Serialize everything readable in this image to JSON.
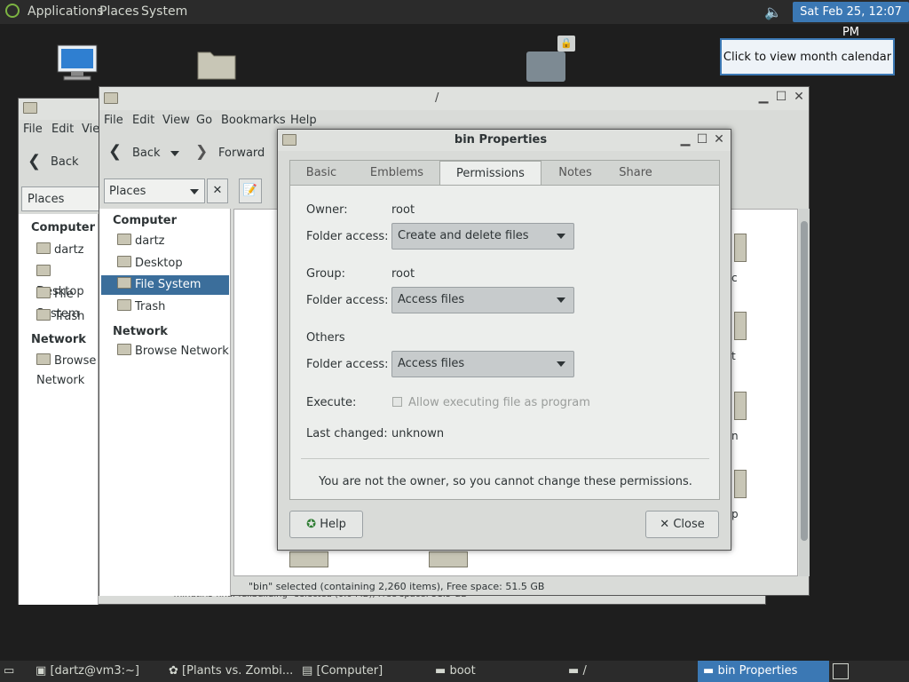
{
  "top_panel": {
    "menus": [
      "Applications",
      "Places",
      "System"
    ],
    "clock": "Sat Feb 25, 12:07 PM",
    "tooltip": "Click to view month calendar"
  },
  "desktop": {
    "icons": [
      {
        "label": "Computer",
        "icon": "computer-icon"
      },
      {
        "label": "",
        "icon": "folder-icon"
      }
    ]
  },
  "back_window": {
    "menus": [
      "File",
      "Edit",
      "View"
    ],
    "back_label": "Back",
    "location": "Places",
    "sidebar": {
      "computer_heading": "Computer",
      "items": [
        "dartz",
        "Desktop",
        "File System",
        "Trash"
      ],
      "network_heading": "Network",
      "network_items": [
        "Browse Network"
      ]
    },
    "status": "\"minutiris-final-fullbuilding\" selected (0.0 MB), Free space: 51.5 GB"
  },
  "main_window": {
    "title": "/",
    "menus": [
      "File",
      "Edit",
      "View",
      "Go",
      "Bookmarks",
      "Help"
    ],
    "back_label": "Back",
    "forward_label": "Forward",
    "location": "Places",
    "sidebar": {
      "computer_heading": "Computer",
      "items": [
        "dartz",
        "Desktop",
        "File System",
        "Trash"
      ],
      "selected_item": "File System",
      "network_heading": "Network",
      "network_items": [
        "Browse Network"
      ]
    },
    "file_labels": [
      "c",
      "t",
      "n",
      "p"
    ],
    "status": "\"bin\" selected (containing 2,260 items), Free space: 51.5 GB"
  },
  "dialog": {
    "title": "bin Properties",
    "tabs": [
      "Basic",
      "Emblems",
      "Permissions",
      "Notes",
      "Share"
    ],
    "active_tab": "Permissions",
    "owner_label": "Owner:",
    "owner_value": "root",
    "folder_access_label": "Folder access:",
    "owner_access": "Create and delete files",
    "group_label": "Group:",
    "group_value": "root",
    "group_access": "Access files",
    "others_label": "Others",
    "others_access": "Access files",
    "execute_label": "Execute:",
    "execute_checkbox": "Allow executing file as program",
    "last_changed_label": "Last changed:",
    "last_changed_value": "unknown",
    "notice": "You are not the owner, so you cannot change these permissions.",
    "help_button": "Help",
    "close_button": "Close"
  },
  "taskbar": {
    "items": [
      "[dartz@vm3:~]",
      "[Plants vs. Zombi...",
      "[Computer]",
      "boot",
      "/",
      "bin Properties"
    ],
    "active_item": "bin Properties"
  },
  "colors": {
    "accent": "#3b78b4",
    "panel": "#2b2b2b",
    "window": "#d9dbd8"
  }
}
